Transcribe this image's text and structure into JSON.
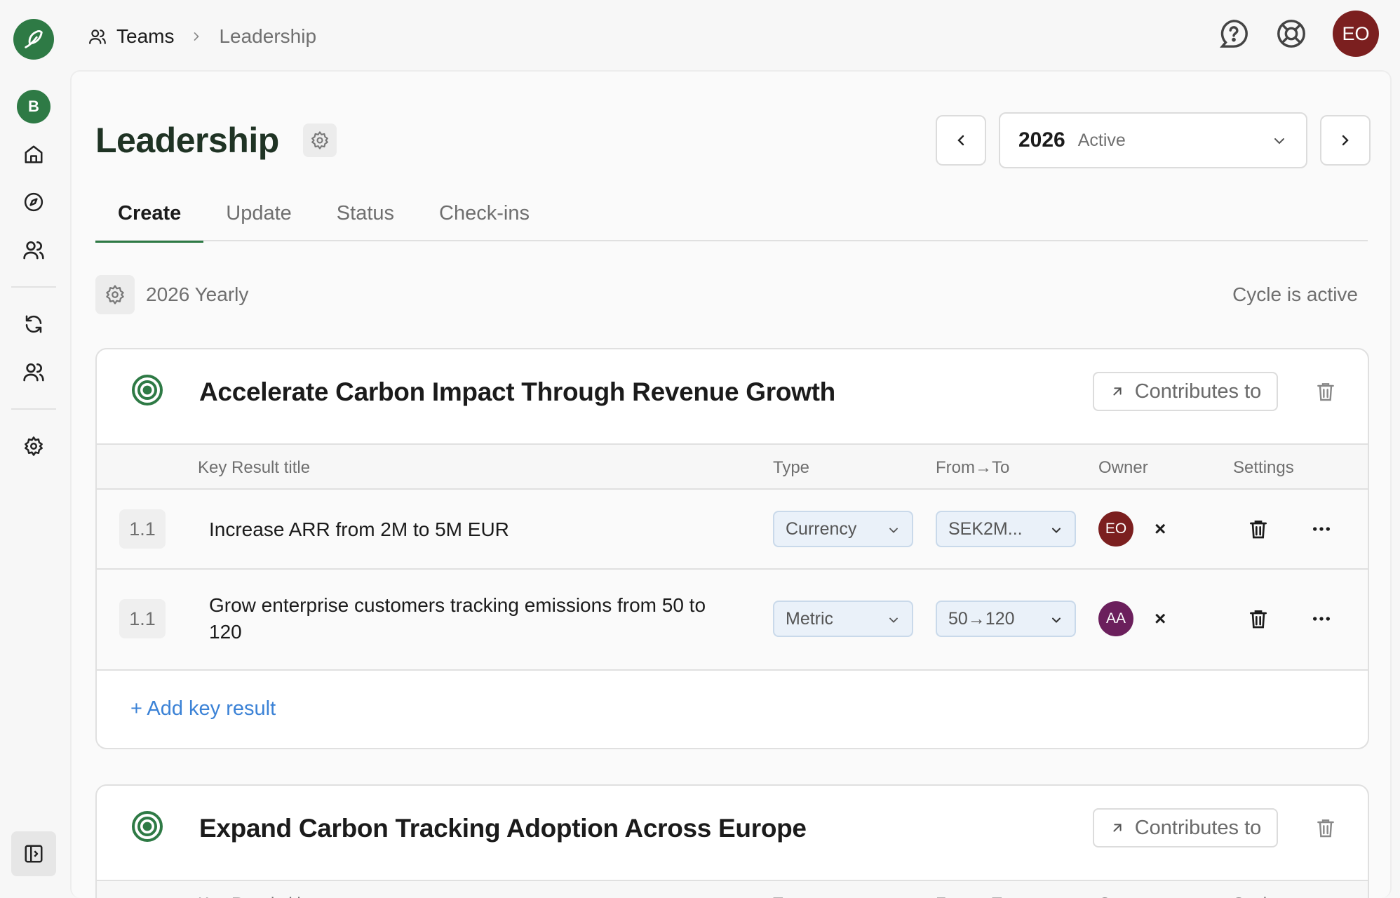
{
  "rail": {
    "workspace_initial": "B"
  },
  "breadcrumb": {
    "teams": "Teams",
    "current": "Leadership"
  },
  "user": {
    "initials": "EO"
  },
  "page": {
    "title": "Leadership"
  },
  "cycle": {
    "year": "2026",
    "status": "Active",
    "name": "2026 Yearly",
    "active_text": "Cycle is active"
  },
  "tabs": [
    {
      "label": "Create",
      "active": true
    },
    {
      "label": "Update",
      "active": false
    },
    {
      "label": "Status",
      "active": false
    },
    {
      "label": "Check-ins",
      "active": false
    }
  ],
  "kr_columns": {
    "title": "Key Result title",
    "type": "Type",
    "from_to": "From→To",
    "owner": "Owner",
    "settings": "Settings"
  },
  "objectives": [
    {
      "title": "Accelerate Carbon Impact Through Revenue Growth",
      "contributes_label": "Contributes to",
      "add_label": "+ Add key result",
      "key_results": [
        {
          "num": "1.1",
          "title": "Increase ARR from 2M to 5M EUR",
          "type": "Currency",
          "from_to": "SEK2M...",
          "owner": "EO",
          "owner_color": "#7b1f1f"
        },
        {
          "num": "1.1",
          "title": "Grow enterprise customers tracking emissions from 50 to 120",
          "type": "Metric",
          "from_to": "50→120",
          "owner": "AA",
          "owner_color": "#6b1f5c"
        }
      ]
    },
    {
      "title": "Expand Carbon Tracking Adoption Across Europe",
      "contributes_label": "Contributes to"
    }
  ],
  "colors": {
    "brand": "#2e7a45",
    "link": "#3b82d6"
  }
}
